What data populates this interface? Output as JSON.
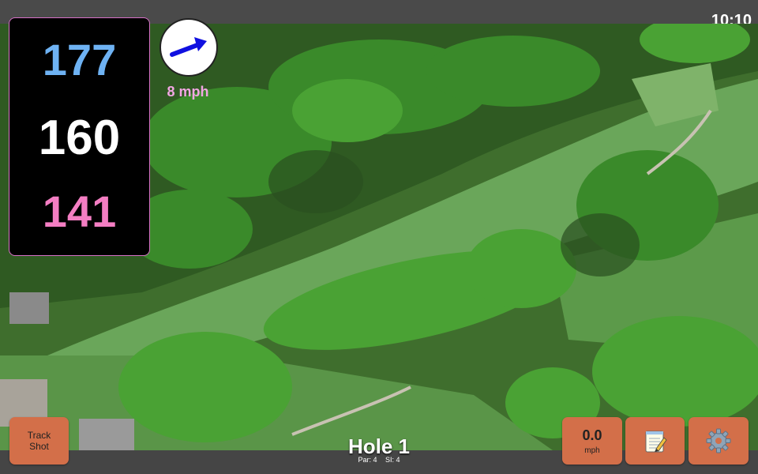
{
  "status_bar": {
    "time": "10:10"
  },
  "distances": {
    "back": "177",
    "middle": "160",
    "front": "141"
  },
  "wind": {
    "speed_text": "8 mph",
    "icon": "wind-direction-arrow-icon",
    "color": "#f2a6e3"
  },
  "hole": {
    "title": "Hole 1",
    "par": "Par: 4",
    "si": "SI: 4"
  },
  "buttons": {
    "track_shot": {
      "line1": "Track",
      "line2": "Shot"
    },
    "speed": {
      "value": "0.0",
      "unit": "mph"
    },
    "notes": {
      "icon": "notepad-icon"
    },
    "settings": {
      "icon": "gear-icon"
    }
  },
  "colors": {
    "back": "#6eb2f3",
    "middle": "#ffffff",
    "front": "#f47ec3",
    "button": "#d36f49",
    "panel_border": "#d770c7"
  }
}
